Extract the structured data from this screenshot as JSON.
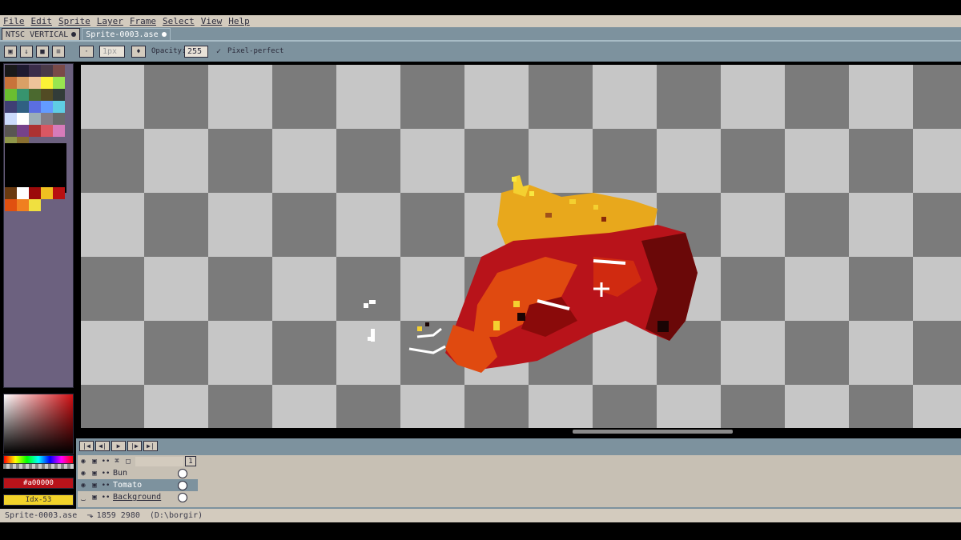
{
  "menu": [
    "File",
    "Edit",
    "Sprite",
    "Layer",
    "Frame",
    "Select",
    "View",
    "Help"
  ],
  "tabs": [
    {
      "label": "NTSC VERTICAL"
    },
    {
      "label": "Sprite-0003.ase"
    }
  ],
  "toolbar": {
    "size_value": "1px",
    "opacity_label": "Opacity:",
    "opacity_value": "255",
    "pixel_perfect_label": "Pixel-perfect"
  },
  "palette": [
    "#1a1a1a",
    "#1e1a30",
    "#3b2d4a",
    "#4a3a48",
    "#7a4a48",
    "#c8733a",
    "#d9a066",
    "#eec39a",
    "#fbf236",
    "#99e550",
    "#6abe30",
    "#37946e",
    "#4b692f",
    "#524b24",
    "#323c39",
    "#3f3f74",
    "#306082",
    "#5b6ee1",
    "#639bff",
    "#5fcde4",
    "#cbdbfc",
    "#ffffff",
    "#9badb7",
    "#847e87",
    "#696a6a",
    "#595652",
    "#76428a",
    "#ac3232",
    "#d95763",
    "#d77bba",
    "#8f974a",
    "#8a6f30"
  ],
  "palette_extra": [
    "#6a3a10",
    "#ffffff",
    "#9b0a0a",
    "#f0c020",
    "#b81010",
    "#e05010",
    "#f08020",
    "#f0e040"
  ],
  "colors": {
    "foreground_label": "#a00000",
    "background_label": "Idx-53"
  },
  "layers": [
    {
      "name": "Bun"
    },
    {
      "name": "Tomato"
    },
    {
      "name": "Background"
    }
  ],
  "frame_number": "1",
  "status": {
    "file": "Sprite-0003.ase",
    "coords": "1859 2980",
    "path": "(D:\\borgir)"
  }
}
